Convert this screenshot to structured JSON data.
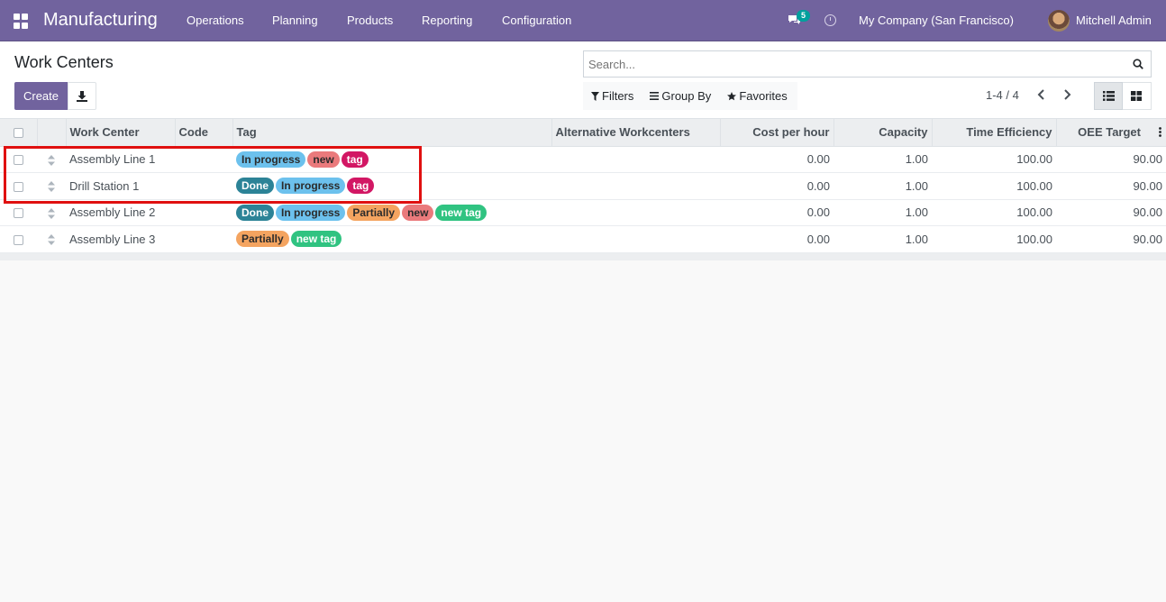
{
  "navbar": {
    "brand": "Manufacturing",
    "menu": [
      "Operations",
      "Planning",
      "Products",
      "Reporting",
      "Configuration"
    ],
    "chat_count": "5",
    "company": "My Company (San Francisco)",
    "user": "Mitchell Admin"
  },
  "control": {
    "title": "Work Centers",
    "create_label": "Create",
    "search_placeholder": "Search...",
    "filters_label": "Filters",
    "groupby_label": "Group By",
    "favorites_label": "Favorites",
    "pager": "1-4 / 4"
  },
  "table": {
    "headers": [
      "Work Center",
      "Code",
      "Tag",
      "Alternative Workcenters",
      "Cost per hour",
      "Capacity",
      "Time Efficiency",
      "OEE Target"
    ],
    "rows": [
      {
        "name": "Assembly Line 1",
        "code": "",
        "tags": [
          {
            "label": "In progress",
            "color": "lightblue"
          },
          {
            "label": "new",
            "color": "salmon"
          },
          {
            "label": "tag",
            "color": "crimson"
          }
        ],
        "alt": "",
        "cost": "0.00",
        "capacity": "1.00",
        "efficiency": "100.00",
        "oee": "90.00"
      },
      {
        "name": "Drill Station 1",
        "code": "",
        "tags": [
          {
            "label": "Done",
            "color": "teal"
          },
          {
            "label": "In progress",
            "color": "lightblue"
          },
          {
            "label": "tag",
            "color": "crimson"
          }
        ],
        "alt": "",
        "cost": "0.00",
        "capacity": "1.00",
        "efficiency": "100.00",
        "oee": "90.00"
      },
      {
        "name": "Assembly Line 2",
        "code": "",
        "tags": [
          {
            "label": "Done",
            "color": "teal"
          },
          {
            "label": "In progress",
            "color": "lightblue"
          },
          {
            "label": "Partially",
            "color": "orange"
          },
          {
            "label": "new",
            "color": "salmon"
          },
          {
            "label": "new tag",
            "color": "green"
          }
        ],
        "alt": "",
        "cost": "0.00",
        "capacity": "1.00",
        "efficiency": "100.00",
        "oee": "90.00"
      },
      {
        "name": "Assembly Line 3",
        "code": "",
        "tags": [
          {
            "label": "Partially",
            "color": "orange"
          },
          {
            "label": "new tag",
            "color": "green"
          }
        ],
        "alt": "",
        "cost": "0.00",
        "capacity": "1.00",
        "efficiency": "100.00",
        "oee": "90.00"
      }
    ]
  },
  "colors": {
    "brand": "#71639e",
    "highlight": "#e01010"
  }
}
